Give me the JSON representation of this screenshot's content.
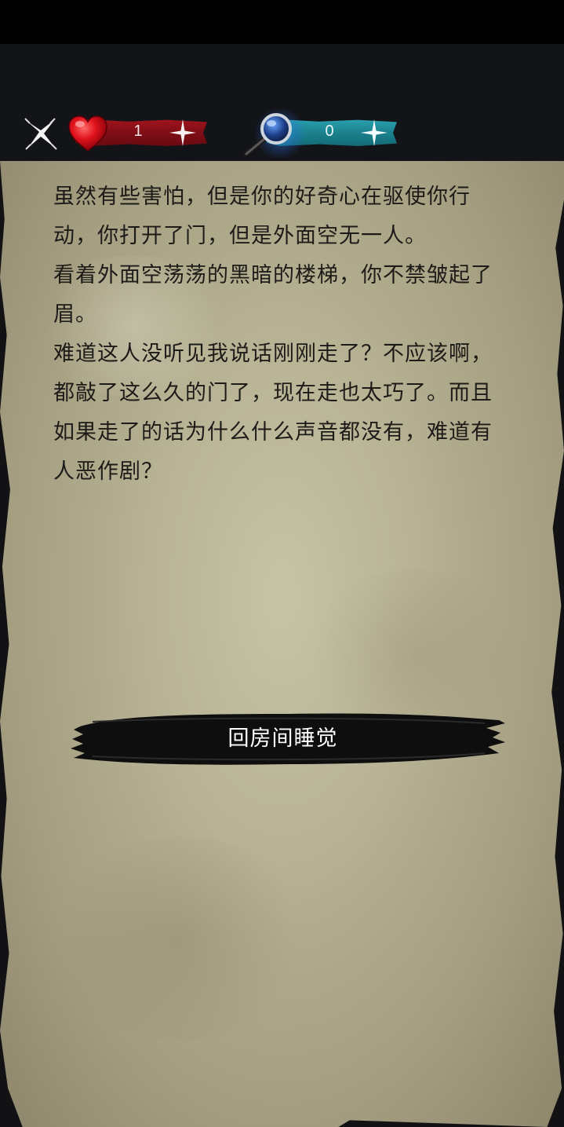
{
  "hud": {
    "close_icon": "close-x-icon",
    "lives": {
      "icon": "heart-icon",
      "count": "1",
      "color": "#8f1119"
    },
    "hints": {
      "icon": "magnifier-icon",
      "count": "0",
      "color": "#1d8794"
    }
  },
  "story": {
    "paragraphs": [
      "虽然有些害怕，但是你的好奇心在驱使你行动，你打开了门，但是外面空无一人。",
      "看着外面空荡荡的黑暗的楼梯，你不禁皱起了眉。",
      "难道这人没听见我说话刚刚走了？不应该啊，都敲了这么久的门了，现在走也太巧了。而且如果走了的话为什么什么声音都没有，难道有人恶作剧？"
    ]
  },
  "choices": [
    {
      "label": "回房间睡觉"
    }
  ],
  "colors": {
    "paper": "#b9b497",
    "ink": "#1c1b18",
    "background": "#131418"
  }
}
